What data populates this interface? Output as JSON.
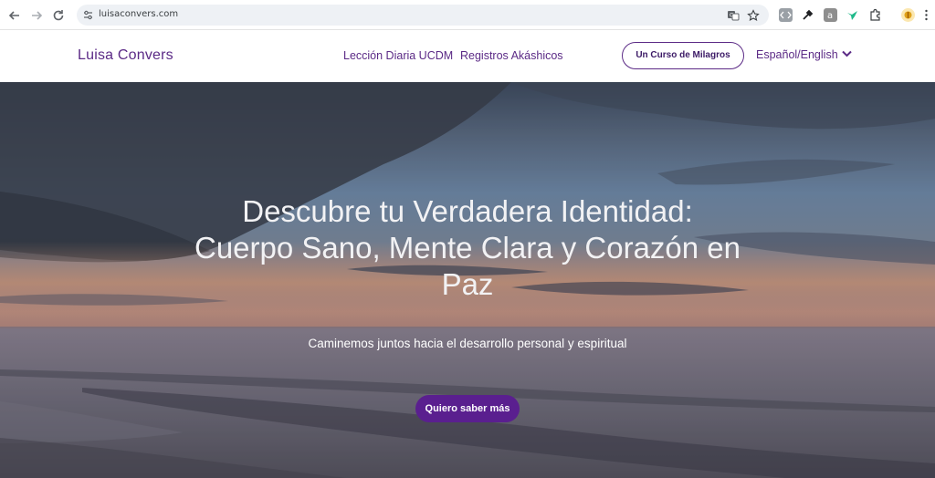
{
  "browser": {
    "url": "luisaconvers.com",
    "icons": {
      "back": "back-arrow-icon",
      "forward": "forward-arrow-icon",
      "reload": "reload-icon",
      "site_controls": "tune-icon",
      "translate": "translate-icon",
      "bookmark": "star-icon",
      "extensions": "puzzle-icon"
    }
  },
  "header": {
    "brand": "Luisa Convers",
    "nav": [
      {
        "label": "Lección Diaria UCDM"
      },
      {
        "label": "Registros Akáshicos"
      }
    ],
    "cta_pill": "Un Curso de Milagros",
    "language": "Español/English"
  },
  "hero": {
    "title": "Descubre tu Verdadera Identidad: Cuerpo Sano, Mente Clara y Corazón en Paz",
    "subtitle": "Caminemos juntos hacia el desarrollo personal y espiritual",
    "button": "Quiero saber más"
  },
  "colors": {
    "brand_purple": "#5b2a86",
    "cta_purple": "#5a1f8f"
  }
}
